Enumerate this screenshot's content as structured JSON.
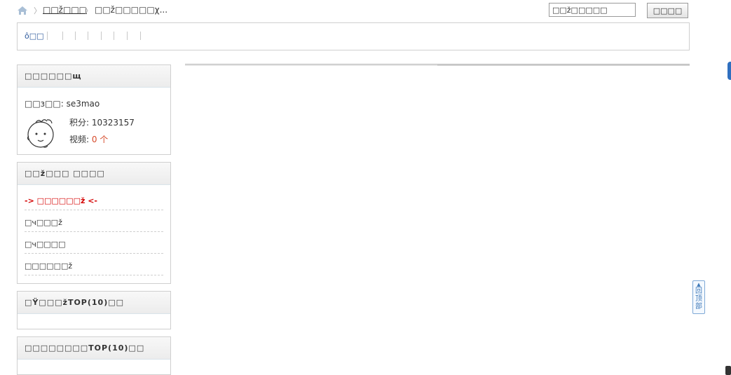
{
  "breadcrumb": {
    "home_icon": "home-icon",
    "link": "□□ž□□□",
    "current": "□□ž□□□□□χ..."
  },
  "search": {
    "value": "□□ž□□□□□",
    "button": "□□□□"
  },
  "nav": {
    "first": "ô□□"
  },
  "user_box": {
    "title": "□□□□□□щ",
    "username_line": "□□з□□: se3mao",
    "points": "积分: 10323157",
    "videos_label": "视频: ",
    "videos_value": "0 个",
    "avatar_icon": "cartoon-face-avatar"
  },
  "menu_box": {
    "title": "□□ž□□□ □□□□",
    "items": [
      "-> □□□□□□ž <-",
      "□ч□□□ž",
      "□ч□□□□",
      "□□□□□□ž"
    ]
  },
  "top_box_1": {
    "title": "□Ÿ□□□žTOP(10)□□"
  },
  "top_box_2": {
    "title": "□□□□□□□□TOP(10)□□"
  },
  "back_top": {
    "arrow": "▲",
    "label": "回顶部"
  },
  "colors": {
    "link_blue": "#2e5a9c",
    "highlight_red": "#d40000",
    "count_red": "#d64a2a"
  }
}
